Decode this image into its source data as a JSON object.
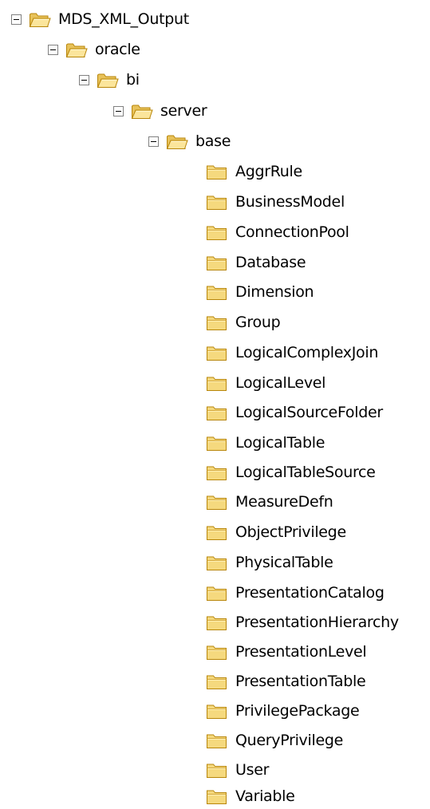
{
  "tree": {
    "root": {
      "label": "MDS_XML_Output",
      "icon": "folder-open-icon",
      "expanded": true
    },
    "level1": {
      "label": "oracle",
      "icon": "folder-open-icon",
      "expanded": true
    },
    "level2": {
      "label": "bi",
      "icon": "folder-open-icon",
      "expanded": true
    },
    "level3": {
      "label": "server",
      "icon": "folder-open-icon",
      "expanded": true
    },
    "level4": {
      "label": "base",
      "icon": "folder-open-icon",
      "expanded": true
    },
    "children": [
      {
        "label": "AggrRule",
        "icon": "folder-icon"
      },
      {
        "label": "BusinessModel",
        "icon": "folder-icon"
      },
      {
        "label": "ConnectionPool",
        "icon": "folder-icon"
      },
      {
        "label": "Database",
        "icon": "folder-icon"
      },
      {
        "label": "Dimension",
        "icon": "folder-icon"
      },
      {
        "label": "Group",
        "icon": "folder-icon"
      },
      {
        "label": "LogicalComplexJoin",
        "icon": "folder-icon"
      },
      {
        "label": "LogicalLevel",
        "icon": "folder-icon"
      },
      {
        "label": "LogicalSourceFolder",
        "icon": "folder-icon"
      },
      {
        "label": "LogicalTable",
        "icon": "folder-icon"
      },
      {
        "label": "LogicalTableSource",
        "icon": "folder-icon"
      },
      {
        "label": "MeasureDefn",
        "icon": "folder-icon"
      },
      {
        "label": "ObjectPrivilege",
        "icon": "folder-icon"
      },
      {
        "label": "PhysicalTable",
        "icon": "folder-icon"
      },
      {
        "label": "PresentationCatalog",
        "icon": "folder-icon"
      },
      {
        "label": "PresentationHierarchy",
        "icon": "folder-icon"
      },
      {
        "label": "PresentationLevel",
        "icon": "folder-icon"
      },
      {
        "label": "PresentationTable",
        "icon": "folder-icon"
      },
      {
        "label": "PrivilegePackage",
        "icon": "folder-icon"
      },
      {
        "label": "QueryPrivilege",
        "icon": "folder-icon"
      },
      {
        "label": "User",
        "icon": "folder-icon"
      },
      {
        "label": "Variable",
        "icon": "folder-icon"
      }
    ]
  },
  "colors": {
    "folder_fill": "#f5d97e",
    "folder_light": "#fff2b8",
    "folder_stroke": "#b8860b",
    "expander_border": "#808080",
    "background": "#ffffff",
    "text": "#000000"
  }
}
